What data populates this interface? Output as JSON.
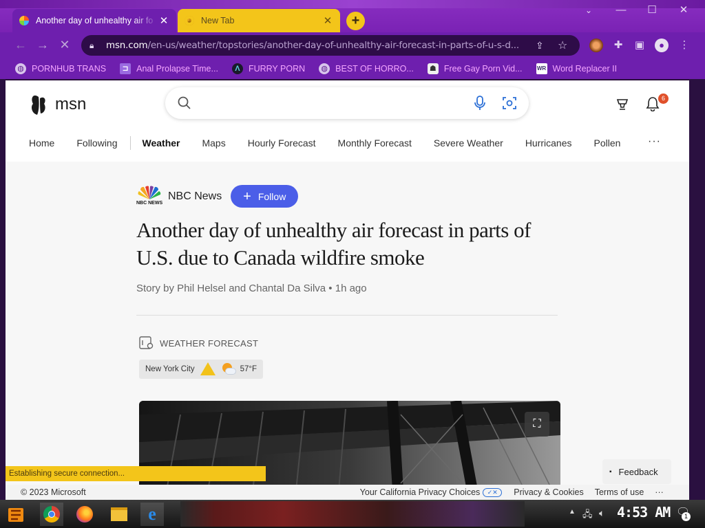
{
  "browser": {
    "tabs": [
      {
        "title": "Another day of unhealthy air fo",
        "close": "✕"
      },
      {
        "title": "New Tab",
        "close": "✕"
      }
    ],
    "new_tab": "+",
    "window": {
      "minimize": "—",
      "maximize": "☐",
      "close": "✕"
    },
    "url": {
      "host": "msn.com",
      "path": "/en-us/weather/topstories/another-day-of-unhealthy-air-forecast-in-parts-of-u-s-d..."
    },
    "bookmarks": [
      {
        "label": "PORNHUB TRANS",
        "icon": "globe-icon"
      },
      {
        "label": "Anal Prolapse Time...",
        "icon": "bookmark-icon"
      },
      {
        "label": "FURRY PORN",
        "icon": "letter-icon"
      },
      {
        "label": "BEST OF HORRO...",
        "icon": "globe-icon"
      },
      {
        "label": "Free Gay Porn Vid...",
        "icon": "site-icon"
      },
      {
        "label": "Word Replacer II",
        "icon": "extension-icon"
      }
    ],
    "status": "Establishing secure connection..."
  },
  "msn": {
    "brand": "msn",
    "search_placeholder": "",
    "notification_count": "6",
    "nav": [
      "Home",
      "Following",
      "Weather",
      "Maps",
      "Hourly Forecast",
      "Monthly Forecast",
      "Severe Weather",
      "Hurricanes",
      "Pollen"
    ],
    "nav_more": "···",
    "feedback": "Feedback"
  },
  "article": {
    "publisher": "NBC News",
    "publisher_logo_text": "NBC NEWS",
    "follow": "Follow",
    "headline": "Another day of unhealthy air forecast in parts of U.S. due to Canada wildfire smoke",
    "byline": "Story by Phil Helsel and Chantal Da Silva • 1h ago",
    "section_label": "WEATHER FORECAST",
    "weather": {
      "city": "New York City",
      "temp": "57°F"
    }
  },
  "footer": {
    "copyright": "© 2023 Microsoft",
    "privacy_choices": "Your California Privacy Choices",
    "privacy_cookies": "Privacy & Cookies",
    "terms": "Terms of use",
    "more": "···"
  },
  "taskbar": {
    "clock": "4:53 AM",
    "notification_count": "1"
  },
  "colors": {
    "accent": "#6e1fae",
    "tab_yellow": "#f3c51a",
    "follow_blue": "#4b5ee8",
    "bookmark_text": "#f4a7ff"
  }
}
